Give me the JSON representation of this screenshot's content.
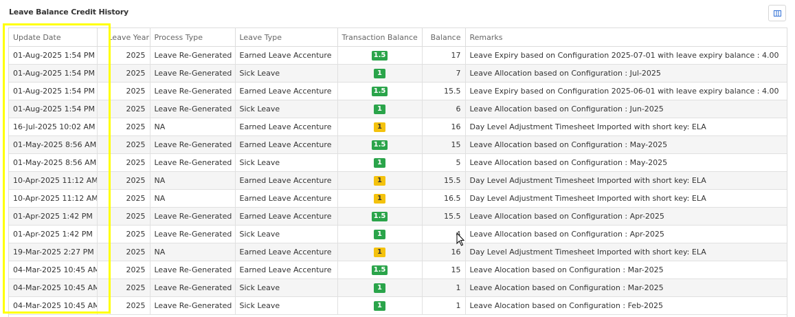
{
  "panel": {
    "title": "Leave Balance Credit History"
  },
  "toolbar": {
    "columns_icon": "columns-icon"
  },
  "table": {
    "headers": [
      "Update Date",
      "",
      "Leave Year",
      "Process Type",
      "Leave Type",
      "Transaction Balance",
      "Balance",
      "Remarks"
    ],
    "rows": [
      {
        "date": "01-Aug-2025 1:54 PM",
        "year": "2025",
        "process": "Leave Re-Generated",
        "type": "Earned Leave Accenture",
        "txn": "1.5",
        "txn_color": "green",
        "balance": "17",
        "remarks": "Leave Expiry based on Configuration 2025-07-01 with leave expiry balance : 4.00"
      },
      {
        "date": "01-Aug-2025 1:54 PM",
        "year": "2025",
        "process": "Leave Re-Generated",
        "type": "Sick Leave",
        "txn": "1",
        "txn_color": "green",
        "balance": "7",
        "remarks": "Leave Allocation based on Configuration : Jul-2025"
      },
      {
        "date": "01-Aug-2025 1:54 PM",
        "year": "2025",
        "process": "Leave Re-Generated",
        "type": "Earned Leave Accenture",
        "txn": "1.5",
        "txn_color": "green",
        "balance": "15.5",
        "remarks": "Leave Expiry based on Configuration 2025-06-01 with leave expiry balance : 4.00"
      },
      {
        "date": "01-Aug-2025 1:54 PM",
        "year": "2025",
        "process": "Leave Re-Generated",
        "type": "Sick Leave",
        "txn": "1",
        "txn_color": "green",
        "balance": "6",
        "remarks": "Leave Allocation based on Configuration : Jun-2025"
      },
      {
        "date": "16-Jul-2025 10:02 AM",
        "year": "2025",
        "process": "NA",
        "type": "Earned Leave Accenture",
        "txn": "1",
        "txn_color": "yellow",
        "balance": "16",
        "remarks": "Day Level Adjustment Timesheet Imported with short key: ELA"
      },
      {
        "date": "01-May-2025 8:56 AM",
        "year": "2025",
        "process": "Leave Re-Generated",
        "type": "Earned Leave Accenture",
        "txn": "1.5",
        "txn_color": "green",
        "balance": "15",
        "remarks": "Leave Allocation based on Configuration : May-2025"
      },
      {
        "date": "01-May-2025 8:56 AM",
        "year": "2025",
        "process": "Leave Re-Generated",
        "type": "Sick Leave",
        "txn": "1",
        "txn_color": "green",
        "balance": "5",
        "remarks": "Leave Allocation based on Configuration : May-2025"
      },
      {
        "date": "10-Apr-2025 11:12 AM",
        "year": "2025",
        "process": "NA",
        "type": "Earned Leave Accenture",
        "txn": "1",
        "txn_color": "yellow",
        "balance": "15.5",
        "remarks": "Day Level Adjustment Timesheet Imported with short key: ELA"
      },
      {
        "date": "10-Apr-2025 11:12 AM",
        "year": "2025",
        "process": "NA",
        "type": "Earned Leave Accenture",
        "txn": "1",
        "txn_color": "yellow",
        "balance": "16.5",
        "remarks": "Day Level Adjustment Timesheet Imported with short key: ELA"
      },
      {
        "date": "01-Apr-2025 1:42 PM",
        "year": "2025",
        "process": "Leave Re-Generated",
        "type": "Earned Leave Accenture",
        "txn": "1.5",
        "txn_color": "green",
        "balance": "15.5",
        "remarks": "Leave Allocation based on Configuration : Apr-2025"
      },
      {
        "date": "01-Apr-2025 1:42 PM",
        "year": "2025",
        "process": "Leave Re-Generated",
        "type": "Sick Leave",
        "txn": "1",
        "txn_color": "green",
        "balance": "4",
        "remarks": "Leave Allocation based on Configuration : Apr-2025"
      },
      {
        "date": "19-Mar-2025 2:27 PM",
        "year": "2025",
        "process": "NA",
        "type": "Earned Leave Accenture",
        "txn": "1",
        "txn_color": "yellow",
        "balance": "16",
        "remarks": "Day Level Adjustment Timesheet Imported with short key: ELA"
      },
      {
        "date": "04-Mar-2025 10:45 AM",
        "year": "2025",
        "process": "Leave Re-Generated",
        "type": "Earned Leave Accenture",
        "txn": "1.5",
        "txn_color": "green",
        "balance": "15",
        "remarks": "Leave Alocation based on Configuration : Mar-2025"
      },
      {
        "date": "04-Mar-2025 10:45 AM",
        "year": "2025",
        "process": "Leave Re-Generated",
        "type": "Sick Leave",
        "txn": "1",
        "txn_color": "green",
        "balance": "1",
        "remarks": "Leave Alocation based on Configuration : Mar-2025"
      },
      {
        "date": "04-Mar-2025 10:45 AM",
        "year": "2025",
        "process": "Leave Re-Generated",
        "type": "Sick Leave",
        "txn": "1",
        "txn_color": "green",
        "balance": "1",
        "remarks": "Leave Alocation based on Configuration : Feb-2025"
      }
    ]
  }
}
